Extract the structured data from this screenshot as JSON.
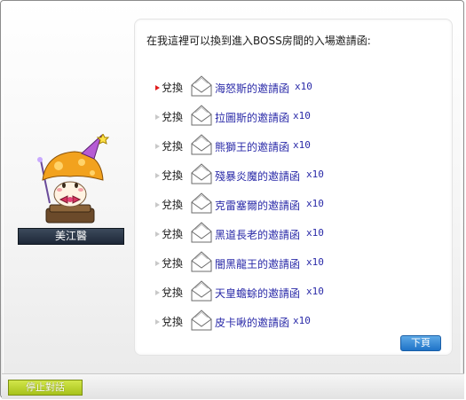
{
  "dialog": {
    "prompt": "在我這裡可以換到進入BOSS房間的入場邀請函:",
    "options": [
      {
        "exchange": "兌換",
        "item": "海怒斯的邀請函",
        "qty": "x10",
        "selected": true
      },
      {
        "exchange": "兌換",
        "item": "拉圖斯的邀請函",
        "qty": "x10",
        "selected": false
      },
      {
        "exchange": "兌換",
        "item": "熊獅王的邀請函",
        "qty": "x10",
        "selected": false
      },
      {
        "exchange": "兌換",
        "item": "殘暴炎魔的邀請函",
        "qty": "x10",
        "selected": false
      },
      {
        "exchange": "兌換",
        "item": "克雷塞爾的邀請函",
        "qty": "x10",
        "selected": false
      },
      {
        "exchange": "兌換",
        "item": "黑道長老的邀請函",
        "qty": "x10",
        "selected": false
      },
      {
        "exchange": "兌換",
        "item": "闇黑龍王的邀請函",
        "qty": "x10",
        "selected": false
      },
      {
        "exchange": "兌換",
        "item": "天皇蟾蜍的邀請函",
        "qty": "x10",
        "selected": false
      },
      {
        "exchange": "兌換",
        "item": "皮卡啾的邀請函",
        "qty": "x10",
        "selected": false
      }
    ],
    "next_label": "下頁"
  },
  "npc": {
    "name": "美江醫"
  },
  "footer": {
    "end_chat_label": "停止對話"
  },
  "colors": {
    "link": "#2a2aa8",
    "selected_bullet": "#e01c1c",
    "npc_plate": "#1e2838",
    "end_button": "#a7c21b"
  },
  "icons": {
    "item": "envelope-icon"
  }
}
